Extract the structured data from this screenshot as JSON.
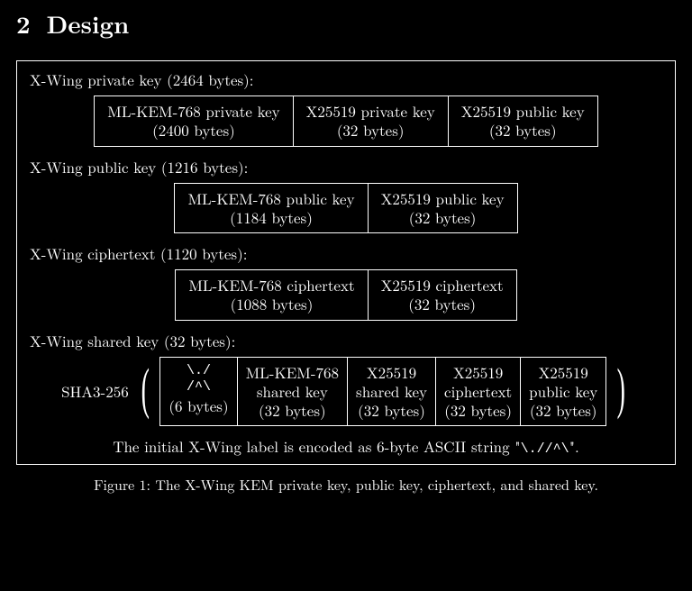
{
  "section": {
    "number": "2",
    "title": "Design"
  },
  "priv": {
    "title": "X-Wing private key (2464 bytes):",
    "cells": [
      {
        "l1": "ML-KEM-768 private key",
        "l2": "(2400 bytes)"
      },
      {
        "l1": "X25519 private key",
        "l2": "(32 bytes)"
      },
      {
        "l1": "X25519 public key",
        "l2": "(32 bytes)"
      }
    ]
  },
  "pub": {
    "title": "X-Wing public key (1216 bytes):",
    "cells": [
      {
        "l1": "ML-KEM-768 public key",
        "l2": "(1184 bytes)"
      },
      {
        "l1": "X25519 public key",
        "l2": "(32 bytes)"
      }
    ]
  },
  "ct": {
    "title": "X-Wing ciphertext (1120 bytes):",
    "cells": [
      {
        "l1": "ML-KEM-768 ciphertext",
        "l2": "(1088 bytes)"
      },
      {
        "l1": "X25519 ciphertext",
        "l2": "(32 bytes)"
      }
    ]
  },
  "ss": {
    "title": "X-Wing shared key (32 bytes):",
    "hash": "SHA3-256",
    "ascii_l1": "\\./",
    "ascii_l2": "/^\\",
    "cells": [
      {
        "l1": "",
        "l2": "(6 bytes)"
      },
      {
        "l1": "ML-KEM-768",
        "l1b": "shared key",
        "l2": "(32 bytes)"
      },
      {
        "l1": "X25519",
        "l1b": "shared key",
        "l2": "(32 bytes)"
      },
      {
        "l1": "X25519",
        "l1b": "ciphertext",
        "l2": "(32 bytes)"
      },
      {
        "l1": "X25519",
        "l1b": "public key",
        "l2": "(32 bytes)"
      }
    ]
  },
  "label_note_pre": "The initial X-Wing label is encoded as 6-byte ASCII string \"",
  "label_note_ascii": "\\.//^\\",
  "label_note_post": "\".",
  "caption": "Figure 1: The X-Wing KEM private key, public key, ciphertext, and shared key."
}
